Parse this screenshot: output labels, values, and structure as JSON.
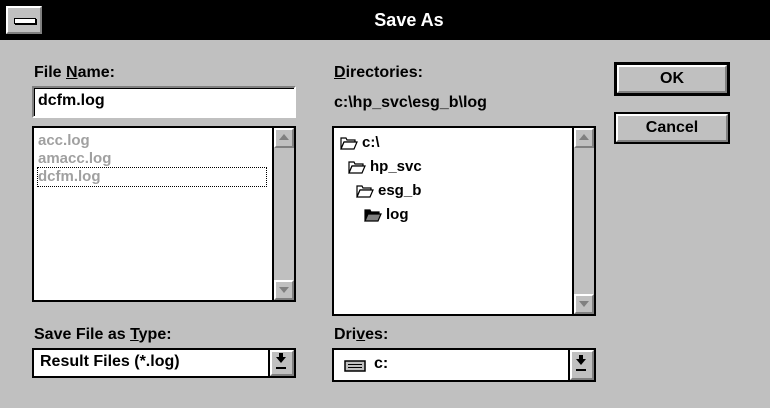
{
  "window": {
    "title": "Save As",
    "system_menu_icon": "system-menu-icon"
  },
  "file_name": {
    "label_prefix": "File ",
    "label_hotkey": "N",
    "label_suffix": "ame:",
    "value": "dcfm.log",
    "files": [
      "acc.log",
      "amacc.log",
      "dcfm.log"
    ],
    "selected_index": 2
  },
  "directories": {
    "label_hotkey": "D",
    "label_suffix": "irectories:",
    "current_path": "c:\\hp_svc\\esg_b\\log",
    "tree": [
      {
        "name": "c:\\",
        "level": 0,
        "icon": "open-folder-icon"
      },
      {
        "name": "hp_svc",
        "level": 1,
        "icon": "open-folder-icon"
      },
      {
        "name": "esg_b",
        "level": 2,
        "icon": "open-folder-icon"
      },
      {
        "name": "log",
        "level": 3,
        "icon": "open-folder-selected-icon"
      }
    ]
  },
  "save_type": {
    "label_prefix": "Save File as ",
    "label_hotkey": "T",
    "label_suffix": "ype:",
    "value": "Result Files (*.log)"
  },
  "drives": {
    "label_prefix": "Dri",
    "label_hotkey": "v",
    "label_suffix": "es:",
    "value": "c:",
    "icon": "drive-icon"
  },
  "buttons": {
    "ok": "OK",
    "cancel": "Cancel"
  }
}
